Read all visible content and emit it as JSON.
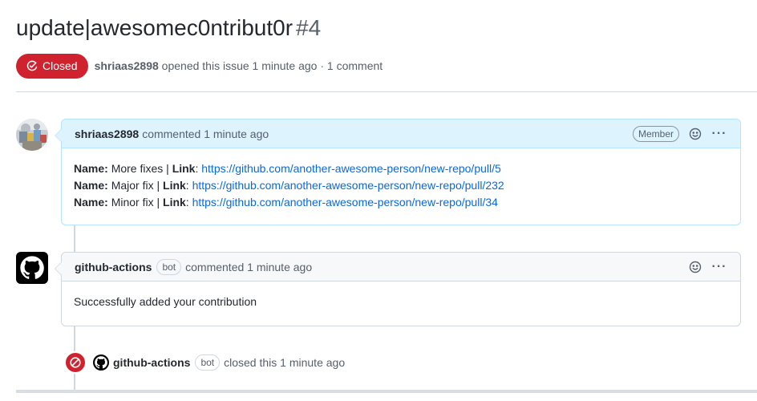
{
  "issue": {
    "title": "update|awesomec0ntribut0r",
    "number": "#4",
    "state": "Closed",
    "state_color": "#cf222e",
    "author": "shriaas2898",
    "meta": "opened this issue 1 minute ago · 1 comment"
  },
  "comments": [
    {
      "author": "shriaas2898",
      "action": "commented 1 minute ago",
      "role": "Member",
      "lines": [
        {
          "name_label": "Name:",
          "name": "More fixes",
          "sep": "|",
          "link_label": "Link",
          "colon": ":",
          "url": "https://github.com/another-awesome-person/new-repo/pull/5"
        },
        {
          "name_label": "Name:",
          "name": "Major fix",
          "sep": "|",
          "link_label": "Link",
          "colon": ":",
          "url": "https://github.com/another-awesome-person/new-repo/pull/232"
        },
        {
          "name_label": "Name:",
          "name": "Minor fix",
          "sep": "|",
          "link_label": "Link",
          "colon": ":",
          "url": "https://github.com/another-awesome-person/new-repo/pull/34"
        }
      ]
    },
    {
      "author": "github-actions",
      "bot": "bot",
      "action": "commented 1 minute ago",
      "body": "Successfully added your contribution"
    }
  ],
  "event": {
    "author": "github-actions",
    "bot": "bot",
    "text": "closed this 1 minute ago"
  },
  "icons": {
    "state": "issue-closed-icon",
    "reaction": "smiley-icon",
    "menu": "kebab-horizontal-icon",
    "avatar_bot": "github-mark-icon",
    "event": "skip-icon"
  },
  "colors": {
    "link": "#0969da",
    "danger": "#cf222e",
    "member_header": "#ddf4ff"
  }
}
